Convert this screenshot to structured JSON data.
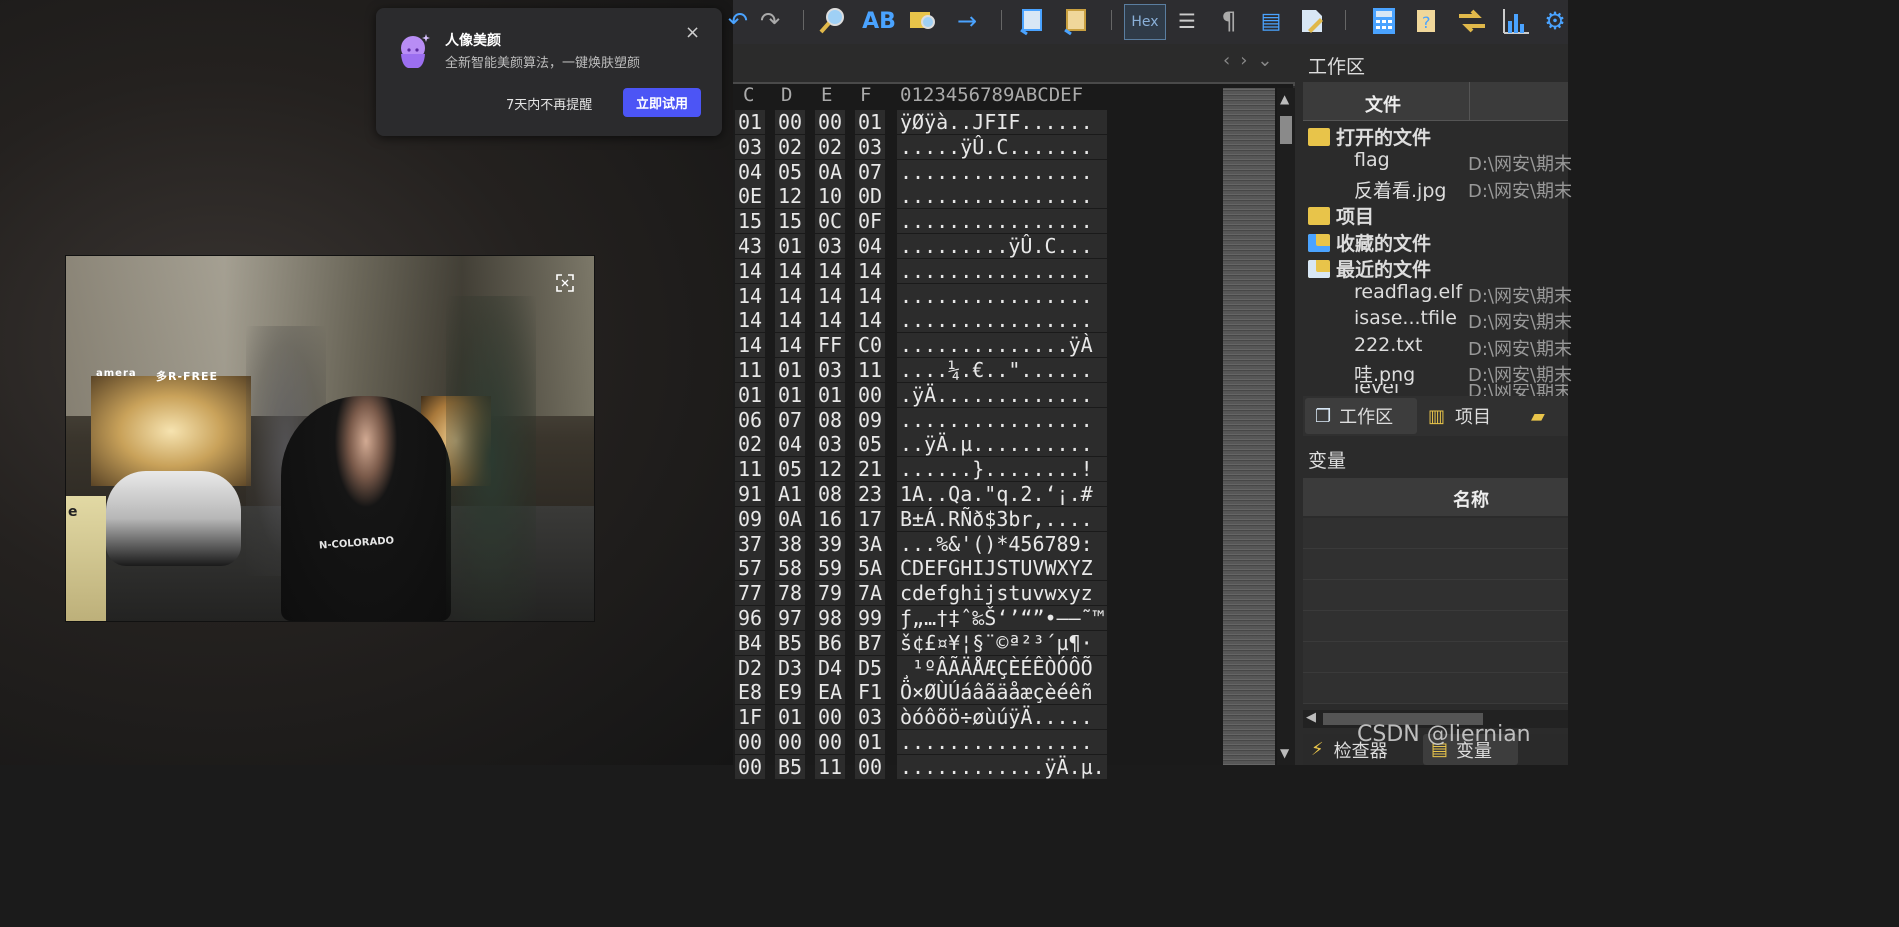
{
  "popup": {
    "title": "人像美颜",
    "desc": "全新智能美颜算法，一键焕肤塑颜",
    "close": "×",
    "no_remind": "7天内不再提醒",
    "try_now": "立即试用"
  },
  "photo": {
    "sign_text": "多R-FREE",
    "shop_text": "amera",
    "shirt_text": "N-COLORADO",
    "corner_text": "e"
  },
  "toolbar": {
    "hex_label": "Hex"
  },
  "hex": {
    "header_bytes": [
      "C",
      "D",
      "E",
      "F"
    ],
    "header_ascii": "0123456789ABCDEF",
    "rows": [
      {
        "b": [
          "01",
          "00",
          "00",
          "01"
        ],
        "a": "ÿØÿà..JFIF......"
      },
      {
        "b": [
          "03",
          "02",
          "02",
          "03"
        ],
        "a": ".....ÿÛ.C......."
      },
      {
        "b": [
          "04",
          "05",
          "0A",
          "07"
        ],
        "a": "................"
      },
      {
        "b": [
          "0E",
          "12",
          "10",
          "0D"
        ],
        "a": "................"
      },
      {
        "b": [
          "15",
          "15",
          "0C",
          "0F"
        ],
        "a": "................"
      },
      {
        "b": [
          "43",
          "01",
          "03",
          "04"
        ],
        "a": ".........ÿÛ.C..."
      },
      {
        "b": [
          "14",
          "14",
          "14",
          "14"
        ],
        "a": "................"
      },
      {
        "b": [
          "14",
          "14",
          "14",
          "14"
        ],
        "a": "................"
      },
      {
        "b": [
          "14",
          "14",
          "14",
          "14"
        ],
        "a": "................"
      },
      {
        "b": [
          "14",
          "14",
          "FF",
          "C0"
        ],
        "a": "..............ÿÀ"
      },
      {
        "b": [
          "11",
          "01",
          "03",
          "11"
        ],
        "a": "....¼.€..\"......"
      },
      {
        "b": [
          "01",
          "01",
          "01",
          "00"
        ],
        "a": ".ÿÄ............."
      },
      {
        "b": [
          "06",
          "07",
          "08",
          "09"
        ],
        "a": "................"
      },
      {
        "b": [
          "02",
          "04",
          "03",
          "05"
        ],
        "a": "..ÿÄ.µ.........."
      },
      {
        "b": [
          "11",
          "05",
          "12",
          "21"
        ],
        "a": "......}........!"
      },
      {
        "b": [
          "91",
          "A1",
          "08",
          "23"
        ],
        "a": "1A..Qa.\"q.2.‘¡.#"
      },
      {
        "b": [
          "09",
          "0A",
          "16",
          "17"
        ],
        "a": "B±Á.RÑð$3br,...."
      },
      {
        "b": [
          "37",
          "38",
          "39",
          "3A"
        ],
        "a": "...%&'()*456789:"
      },
      {
        "b": [
          "57",
          "58",
          "59",
          "5A"
        ],
        "a": "CDEFGHIJSTUVWXYZ"
      },
      {
        "b": [
          "77",
          "78",
          "79",
          "7A"
        ],
        "a": "cdefghijstuvwxyz"
      },
      {
        "b": [
          "96",
          "97",
          "98",
          "99"
        ],
        "a": "ƒ„…†‡ˆ‰Š‘’“”•–—˜™"
      },
      {
        "b": [
          "B4",
          "B5",
          "B6",
          "B7"
        ],
        "a": "š¢£¤¥¦§¨©ª²³´µ¶·"
      },
      {
        "b": [
          "D2",
          "D3",
          "D4",
          "D5"
        ],
        "a": "¸¹ºÂÃÄÅÆÇÈÉÊÒÓÔÕ"
      },
      {
        "b": [
          "E8",
          "E9",
          "EA",
          "F1"
        ],
        "a": "Ö×ØÙÚáâãäåæçèéêñ"
      },
      {
        "b": [
          "1F",
          "01",
          "00",
          "03"
        ],
        "a": "òóôõö÷øùúÿÄ....."
      },
      {
        "b": [
          "00",
          "00",
          "00",
          "01"
        ],
        "a": "................"
      },
      {
        "b": [
          "00",
          "B5",
          "11",
          "00"
        ],
        "a": "............ÿÄ.µ."
      }
    ]
  },
  "side": {
    "workspace_title": "工作区",
    "col_file": "文件",
    "open_files": "打开的文件",
    "files": [
      {
        "name": "flag",
        "path": "D:\\网安\\期末"
      },
      {
        "name": "反着看.jpg",
        "path": "D:\\网安\\期末"
      }
    ],
    "project": "项目",
    "favorites": "收藏的文件",
    "recent": "最近的文件",
    "recent_files": [
      {
        "name": "readflag.elf",
        "path": "D:\\网安\\期末"
      },
      {
        "name": "isase...tfile",
        "path": "D:\\网安\\期末"
      },
      {
        "name": "222.txt",
        "path": "D:\\网安\\期末"
      },
      {
        "name": "哇.png",
        "path": "D:\\网安\\期末"
      },
      {
        "name": "level",
        "path": "D:\\网安\\期末"
      }
    ],
    "tab_workspace": "工作区",
    "tab_project": "项目",
    "var_title": "变量",
    "var_col_name": "名称",
    "bottom_inspector": "检查器",
    "bottom_vars": "变量"
  },
  "watermark": "CSDN @liernian"
}
